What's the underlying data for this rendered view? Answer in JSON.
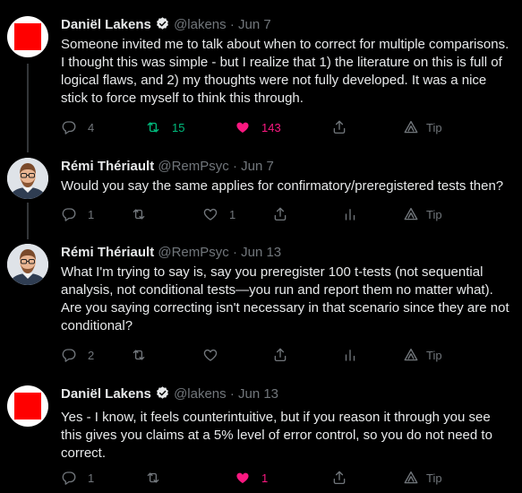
{
  "tweets": [
    {
      "name": "Daniël Lakens",
      "handle": "@lakens",
      "time": "· Jun 7",
      "avatar_color": "#ff0000",
      "text": "Someone invited me to talk about when to correct for multiple comparisons. I thought this was simple - but I realize that 1) the literature on this is full of logical flaws, and 2) my thoughts were not fully developed. It was a nice stick to force myself to think this through.",
      "replies": "4",
      "retweets": "15",
      "likes": "143",
      "tip": "Tip"
    },
    {
      "name": "Rémi Thériault",
      "handle": "@RemPsyc",
      "time": "· Jun 7",
      "text": "Would you say the same applies for confirmatory/preregistered tests then?",
      "replies": "1",
      "retweets": "",
      "likes": "1",
      "tip": "Tip"
    },
    {
      "name": "Rémi Thériault",
      "handle": "@RemPsyc",
      "time": "· Jun 13",
      "text": "What I'm trying to say is, say you preregister 100 t-tests (not sequential analysis, not conditional tests—you run and report them no matter what). Are you saying correcting isn't necessary in that scenario since they are not conditional?",
      "replies": "2",
      "retweets": "",
      "likes": "",
      "tip": "Tip"
    },
    {
      "name": "Daniël Lakens",
      "handle": "@lakens",
      "time": "· Jun 13",
      "avatar_color": "#ff0000",
      "text": "Yes - I know, it feels counterintuitive, but if you reason it through you see this gives you claims at a 5% level of error control, so you do not need to correct.",
      "replies": "1",
      "retweets": "",
      "likes": "1",
      "tip": "Tip"
    }
  ],
  "colors": {
    "background": "#000000",
    "text": "#e7e9ea",
    "muted": "#71767b",
    "retweet_active": "#00ba7c",
    "like_active": "#f91880",
    "verified": "#e7e9ea"
  }
}
